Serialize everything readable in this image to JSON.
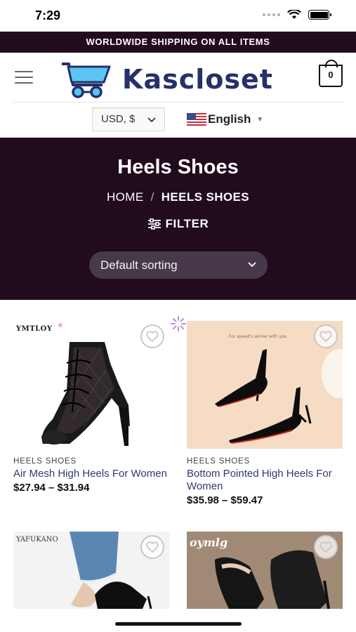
{
  "status": {
    "time": "7:29"
  },
  "promo": {
    "text": "WORLDWIDE SHIPPING ON ALL ITEMS"
  },
  "header": {
    "logo_text": "Kascloset",
    "cart_count": "0"
  },
  "selectors": {
    "currency": "USD, $",
    "language": "English"
  },
  "hero": {
    "title": "Heels Shoes",
    "breadcrumb": {
      "home": "HOME",
      "separator": "/",
      "current": "HEELS SHOES"
    },
    "filter_label": "FILTER",
    "sort_label": "Default sorting"
  },
  "products": [
    {
      "category": "HEELS SHOES",
      "name": "Air Mesh High Heels For Women",
      "price": "$27.94 – $31.94",
      "brand": "YMTLOY"
    },
    {
      "category": "HEELS SHOES",
      "name": "Bottom Pointed High Heels For Women",
      "price": "$35.98 – $59.47",
      "brand": ""
    },
    {
      "category": "",
      "name": "",
      "price": "",
      "brand": "YAFUKANO"
    },
    {
      "category": "",
      "name": "",
      "price": "",
      "brand": "oymlg"
    }
  ],
  "colors": {
    "dark_bg": "#210b1c",
    "logo_navy": "#25306b",
    "product_link": "#2d3a6f",
    "sort_bg": "#47394a"
  }
}
